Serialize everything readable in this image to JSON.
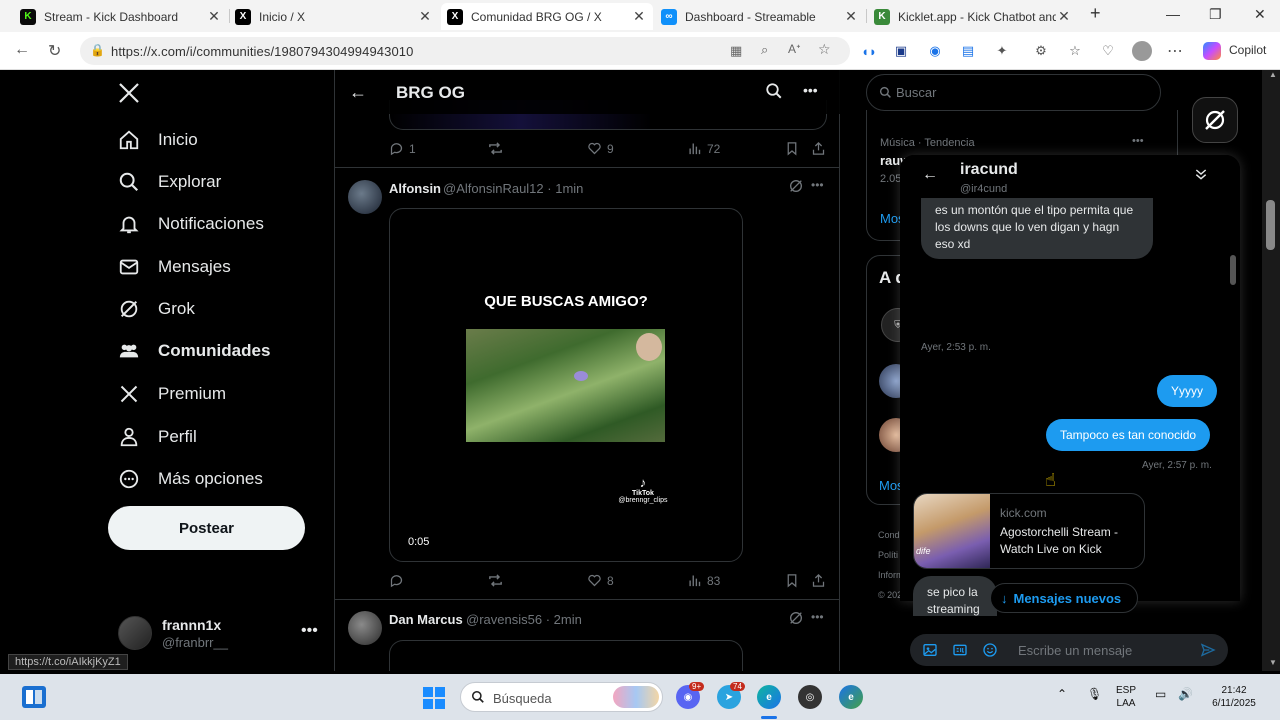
{
  "browser": {
    "tabs": [
      {
        "title": "Stream - Kick Dashboard",
        "icon": "kick-icon",
        "color": "#53fc18",
        "active": false
      },
      {
        "title": "Inicio / X",
        "icon": "x-logo-icon",
        "color": "#000000",
        "active": false
      },
      {
        "title": "Comunidad BRG OG / X",
        "icon": "x-logo-icon",
        "color": "#000000",
        "active": true
      },
      {
        "title": "Dashboard - Streamable",
        "icon": "streamable-icon",
        "color": "#0f90fa",
        "active": false
      },
      {
        "title": "Kicklet.app - Kick Chatbot and",
        "icon": "kicklet-icon",
        "color": "#3a8a3a",
        "active": false
      }
    ],
    "url": "https://x.com/i/communities/1980794304994943010",
    "copilot_label": "Copilot"
  },
  "nav": {
    "items": [
      {
        "label": "Inicio",
        "icon": "home-icon",
        "bold": false
      },
      {
        "label": "Explorar",
        "icon": "search-icon",
        "bold": false
      },
      {
        "label": "Notificaciones",
        "icon": "bell-icon",
        "bold": false
      },
      {
        "label": "Mensajes",
        "icon": "mail-icon",
        "bold": false
      },
      {
        "label": "Grok",
        "icon": "grok-icon",
        "bold": false
      },
      {
        "label": "Comunidades",
        "icon": "communities-icon",
        "bold": true
      },
      {
        "label": "Premium",
        "icon": "x-logo-icon",
        "bold": false
      },
      {
        "label": "Perfil",
        "icon": "person-icon",
        "bold": false
      },
      {
        "label": "Más opciones",
        "icon": "more-circle-icon",
        "bold": false
      }
    ],
    "post_button": "Postear",
    "user": {
      "name": "frannn1x",
      "handle": "@franbrr__"
    },
    "status_url": "https://t.co/iAIkkjKyZ1"
  },
  "timeline": {
    "title": "BRG OG",
    "prev_tweet_stats": {
      "replies": "1",
      "likes": "9",
      "views": "72"
    },
    "tweets": [
      {
        "name": "Alfonsin",
        "handle": "@AlfonsinRaul12",
        "time": "1min",
        "video_caption": "QUE BUSCAS AMIGO?",
        "video_watermark": "TikTok",
        "video_watermark_handle": "@brenngr_clips",
        "video_time": "0:05",
        "stats": {
          "replies": "",
          "likes": "8",
          "views": "83"
        }
      },
      {
        "name": "Dan Marcus",
        "handle": "@ravensis56",
        "time": "2min"
      }
    ]
  },
  "rail": {
    "search_placeholder": "Buscar",
    "trend": {
      "meta": "Música · Tendencia",
      "name": "rauw alejandro",
      "count": "2.055 publicaciones"
    },
    "show_more": "Mostrar más",
    "who_title_partial": "A q",
    "who_more_partial": "Most",
    "footer_partial": [
      "Condic",
      "Políti",
      "Inform",
      "© 2025"
    ]
  },
  "dm": {
    "name": "iracund",
    "handle": "@ir4cund",
    "messages": [
      {
        "dir": "in",
        "text": "es un montón que el tipo permita que los downs que lo ven  digan y hagn eso xd"
      },
      {
        "dir": "out",
        "text": "Yyyyy"
      },
      {
        "dir": "out",
        "text": "Tampoco es tan conocido"
      },
      {
        "dir": "in",
        "text": "se pico la streaming"
      }
    ],
    "time_1": "Ayer, 2:53 p. m.",
    "time_2": "Ayer, 2:57 p. m.",
    "link_domain": "kick.com",
    "link_title": "Agostorchelli Stream - Watch Live on Kick",
    "link_image_text": "dife",
    "new_messages": "Mensajes nuevos",
    "composer_placeholder": "Escribe un mensaje"
  },
  "taskbar": {
    "search_placeholder": "Búsqueda",
    "badge_discord": "9+",
    "badge_telegram": "74",
    "lang": "ESP",
    "lang_sub": "LAA",
    "time": "21:42",
    "date": "6/11/2025"
  }
}
